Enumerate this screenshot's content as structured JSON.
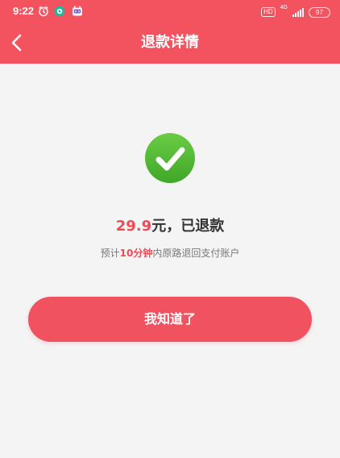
{
  "status_bar": {
    "time": "9:22",
    "hd": "HD",
    "network": "4G",
    "battery": "97"
  },
  "header": {
    "title": "退款详情"
  },
  "refund": {
    "amount": "29.9",
    "amount_suffix": "元，已退款",
    "note_prefix": "预计",
    "note_highlight": "10分钟",
    "note_suffix": "内原路退回支付账户"
  },
  "actions": {
    "confirm_label": "我知道了"
  },
  "colors": {
    "header_bg": "#f2535f",
    "accent": "#ef4a55",
    "success_green": "#49b02f",
    "page_bg": "#f4f4f4"
  },
  "icons": {
    "back": "chevron-left-icon",
    "success": "check-circle-icon",
    "alarm": "alarm-clock-icon",
    "chat": "chat-bubble-icon",
    "app": "app-icon"
  }
}
